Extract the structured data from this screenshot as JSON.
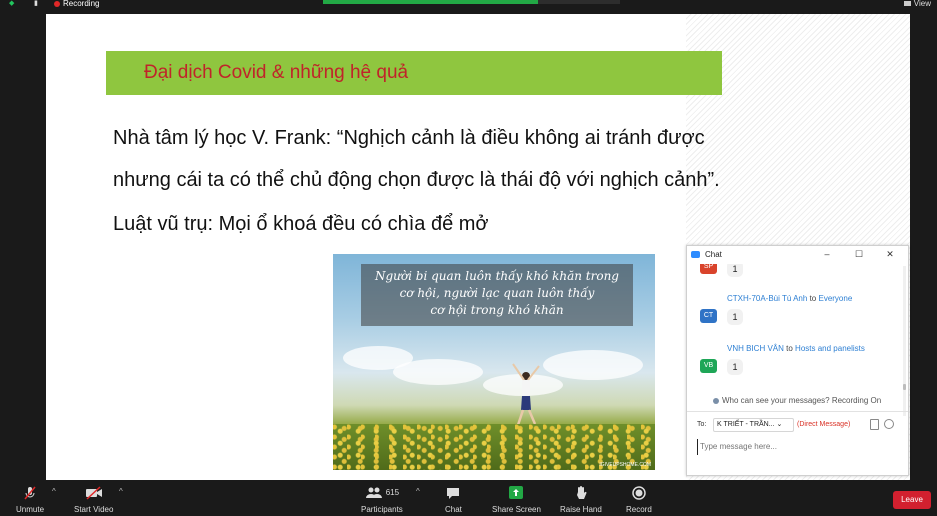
{
  "top_bar": {
    "recording_label": "Recording",
    "view_label": "View"
  },
  "slide": {
    "title": "Đại dịch Covid & những hệ quả",
    "lines": [
      "Nhà tâm lý học V. Frank: “Nghịch cảnh là điều không ai tránh được",
      "nhưng cái ta có thể chủ động chọn được là thái độ với nghịch cảnh”.",
      "Luật vũ trụ: Mọi ổ khoá đều có chìa để mở"
    ],
    "image_quote": [
      "Người bi quan luôn thấy khó khăn trong",
      "cơ hội, người lạc quan luôn thấy",
      "cơ hội trong khó khăn"
    ],
    "image_watermark": "IGIVEUPSHOME.COM"
  },
  "chat": {
    "title": "Chat",
    "messages": [
      {
        "initials": "SP",
        "avatar_color": "#d9432b",
        "sender": "",
        "to": "",
        "recipient": "",
        "text": "1"
      },
      {
        "initials": "CT",
        "avatar_color": "#2f73c6",
        "sender": "CTXH-70A-Bùi Tú Anh",
        "to": "to",
        "recipient": "Everyone",
        "text": "1"
      },
      {
        "initials": "VB",
        "avatar_color": "#1ea657",
        "sender": "VNH BICH VÂN",
        "to": "to",
        "recipient": "Hosts and panelists",
        "text": "1"
      }
    ],
    "who_can_see": "Who can see your messages? Recording On",
    "to_label": "To:",
    "to_value": "K TRIẾT - TRẦN...",
    "direct_message": "(Direct Message)",
    "input_placeholder": "Type message here..."
  },
  "toolbar": {
    "unmute": "Unmute",
    "start_video": "Start Video",
    "participants": "Participants",
    "participants_count": "615",
    "chat": "Chat",
    "share_screen": "Share Screen",
    "raise_hand": "Raise Hand",
    "record": "Record",
    "leave": "Leave"
  },
  "colors": {
    "accent_green": "#22a845",
    "title_bar": "#8fc63f",
    "title_text": "#c0242a",
    "leave_red": "#d2202f",
    "link_blue": "#2d7fd3"
  }
}
